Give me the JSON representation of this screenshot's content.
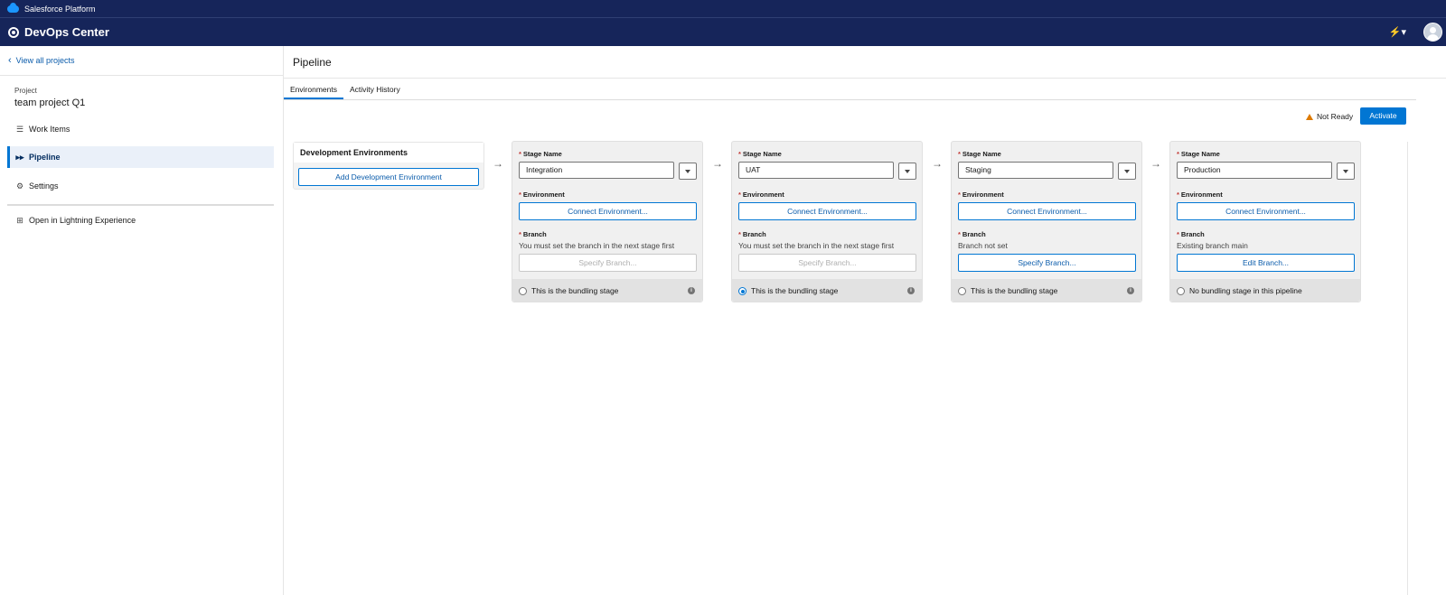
{
  "platform": {
    "name": "Salesforce Platform"
  },
  "app": {
    "title": "DevOps Center"
  },
  "sidebar": {
    "back_link": "View all projects",
    "project_label": "Project",
    "project_name": "team project Q1",
    "items": [
      {
        "label": "Work Items",
        "icon": "list-icon"
      },
      {
        "label": "Pipeline",
        "icon": "pipeline-icon",
        "active": true
      },
      {
        "label": "Settings",
        "icon": "gear-icon"
      },
      {
        "label": "Open in Lightning Experience",
        "icon": "open-external-icon"
      }
    ]
  },
  "main": {
    "title": "Pipeline",
    "tabs": [
      {
        "label": "Environments",
        "active": true
      },
      {
        "label": "Activity History"
      }
    ],
    "status": "Not Ready",
    "activate_label": "Activate",
    "dev_env": {
      "title": "Development Environments",
      "add_button": "Add Development Environment"
    },
    "labels": {
      "stage_name": "Stage Name",
      "environment": "Environment",
      "branch": "Branch",
      "required": "*"
    },
    "stages": [
      {
        "name": "Integration",
        "connect_label": "Connect Environment...",
        "branch_text": "You must set the branch in the next stage first",
        "branch_button": "Specify Branch...",
        "branch_enabled": false,
        "radio_label": "This is the bundling stage",
        "radio_selected": false,
        "info": true
      },
      {
        "name": "UAT",
        "connect_label": "Connect Environment...",
        "branch_text": "You must set the branch in the next stage first",
        "branch_button": "Specify Branch...",
        "branch_enabled": false,
        "radio_label": "This is the bundling stage",
        "radio_selected": true,
        "info": true
      },
      {
        "name": "Staging",
        "connect_label": "Connect Environment...",
        "branch_text": "Branch not set",
        "branch_button": "Specify Branch...",
        "branch_enabled": true,
        "radio_label": "This is the bundling stage",
        "radio_selected": false,
        "info": true
      },
      {
        "name": "Production",
        "connect_label": "Connect Environment...",
        "branch_text": "Existing branch main",
        "branch_button": "Edit Branch...",
        "branch_enabled": true,
        "radio_label": "No bundling stage in this pipeline",
        "radio_selected": false,
        "info": false
      }
    ]
  },
  "colors": {
    "header_bg": "#16255a",
    "brand_blue": "#0176d3",
    "link_blue": "#0b5cab",
    "warning": "#dd7a01",
    "required": "#c23934"
  }
}
